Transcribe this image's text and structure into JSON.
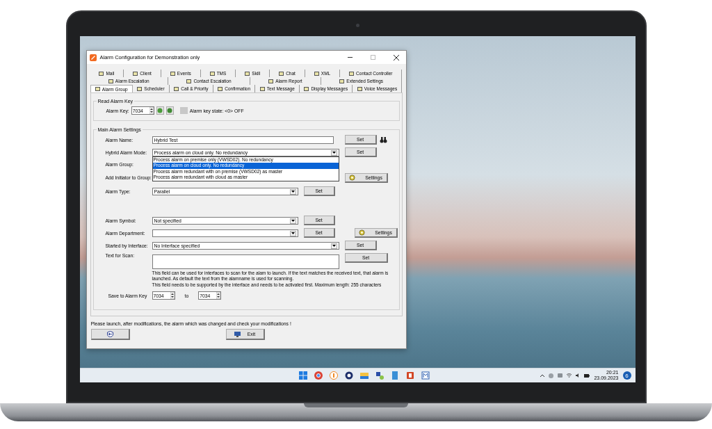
{
  "window": {
    "title": "Alarm Configuration for Demonstration only"
  },
  "tab_rows": [
    [
      {
        "label": "Mail",
        "selected": false
      },
      {
        "label": "Client",
        "selected": false
      },
      {
        "label": "Events",
        "selected": false
      },
      {
        "label": "TMS",
        "selected": false
      },
      {
        "label": "Skill",
        "selected": false
      },
      {
        "label": "Chat",
        "selected": false
      },
      {
        "label": "XML",
        "selected": false
      },
      {
        "label": "Contact Controller",
        "selected": false
      }
    ],
    [
      {
        "label": "Alarm Escalation",
        "selected": false
      },
      {
        "label": "Contact Escalation",
        "selected": false
      },
      {
        "label": "Alarm Report",
        "selected": false
      },
      {
        "label": "Extended Settings",
        "selected": false
      }
    ],
    [
      {
        "label": "Alarm Group",
        "selected": true
      },
      {
        "label": "Scheduler",
        "selected": false
      },
      {
        "label": "Call & Priority",
        "selected": false
      },
      {
        "label": "Confirmation",
        "selected": false
      },
      {
        "label": "Text Message",
        "selected": false
      },
      {
        "label": "Display Messages",
        "selected": false
      },
      {
        "label": "Voice Messages",
        "selected": false
      }
    ]
  ],
  "read_alarm_key": {
    "title": "Read Alarm Key",
    "label": "Alarm Key:",
    "value": "7034",
    "on": false,
    "state_text": "Alarm key state: <0>  OFF"
  },
  "main_settings": {
    "title": "Main Alarm Settings",
    "upper_rows": [
      {
        "kind": "text",
        "label": "Alarm Name:",
        "value": "Hybrid Test",
        "set": "Set"
      },
      {
        "kind": "combo",
        "label": "Hybrid Alarm Mode:",
        "value": "Process alarm on cloud only. No redundancy",
        "set": "Set",
        "expanded": true,
        "options": [
          {
            "label": "Process alarm on premise only (VWSD02). No redundancy",
            "selected": false
          },
          {
            "label": "Process alarm on cloud only. No redundancy",
            "selected": true
          },
          {
            "label": "Process alarm redundant with on premise (VWSD02) as master",
            "selected": false
          },
          {
            "label": "Process alarm redundant with cloud as master",
            "selected": false
          }
        ]
      },
      {
        "kind": "label",
        "label": "Alarm Group:"
      },
      {
        "kind": "label",
        "label": "Add Initiator to Group:",
        "settings": "Settings"
      },
      {
        "kind": "combo-short",
        "label": "Alarm Type:",
        "value": "Parallel",
        "set": "Set"
      }
    ],
    "lower_rows": [
      {
        "kind": "combo-short",
        "label": "Alarm Symbol:",
        "value": "Not specified",
        "set": "Set"
      },
      {
        "kind": "combo-short",
        "label": "Alarm Department:",
        "set": "Set",
        "settings": "Settings"
      },
      {
        "kind": "combo",
        "label": "Started by Interface:",
        "value": "No Interface specified",
        "set": "Set"
      },
      {
        "kind": "multiline",
        "label": "Text for Scan:",
        "set": "Set"
      }
    ],
    "help": [
      "This field can be used for interfaces to scan for the alam to launch. If the text matches the received text, that alarm is launched. As default the text from the alamname is used for scanning.",
      "This field needs to be supported by the interface and needs to be activated first. Maximum length: 255 characters"
    ],
    "save": {
      "label": "Save to Alarm Key",
      "from": "7034",
      "to_label": "to",
      "to": "7034"
    }
  },
  "status_message": "Please launch, after modifications, the alarm which was changed and check your modifications !",
  "exit_button": "Exit",
  "taskbar": {
    "time": "20:21",
    "date": "23.09.2023",
    "notifications": "6"
  }
}
